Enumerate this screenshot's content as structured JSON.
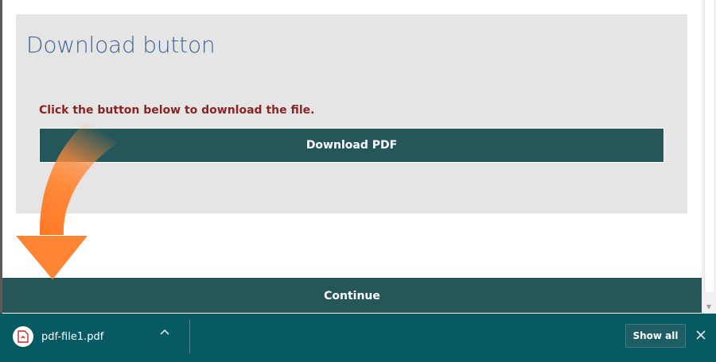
{
  "panel": {
    "title": "Download button",
    "instruction": "Click the button below to download the file.",
    "download_label": "Download PDF"
  },
  "continue_label": "Continue",
  "download_shelf": {
    "file_name": "pdf-file1.pdf",
    "file_icon": "pdf-icon",
    "show_all_label": "Show all",
    "close_icon": "close-icon"
  },
  "colors": {
    "button_bg": "#25575a",
    "shelf_bg": "#075a63",
    "title_text": "#3f6496",
    "instruction_text": "#8b2424",
    "arrow_orange": "#ff8a3a"
  }
}
